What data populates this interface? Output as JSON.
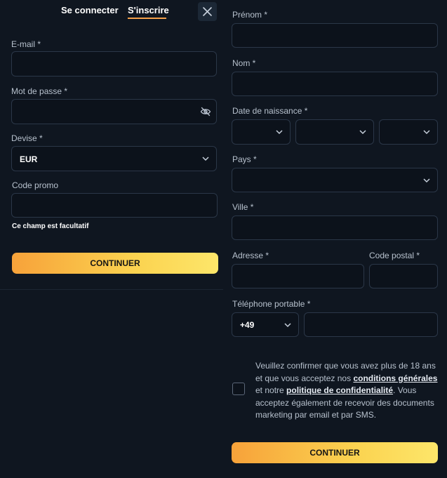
{
  "tabs": {
    "login": "Se connecter",
    "signup": "S'inscrire"
  },
  "left_form": {
    "email_label": "E-mail *",
    "email_value": "",
    "password_label": "Mot de passe *",
    "password_value": "",
    "currency_label": "Devise *",
    "currency_value": "EUR",
    "promo_label": "Code promo",
    "promo_value": "",
    "promo_note": "Ce champ est facultatif",
    "continue_label": "CONTINUER"
  },
  "right_form": {
    "firstname_label": "Prénom *",
    "lastname_label": "Nom *",
    "birthdate_label": "Date de naissance *",
    "country_label": "Pays *",
    "city_label": "Ville *",
    "address_label": "Adresse *",
    "postal_label": "Code postal *",
    "phone_label": "Téléphone portable *",
    "phone_prefix": "+49",
    "consent": {
      "part1": "Veuillez confirmer que vous avez plus de 18 ans et que vous acceptez nos ",
      "link1": "conditions générales",
      "part2": " et notre ",
      "link2": "politique de confidentialité",
      "part3": ". Vous acceptez également de recevoir des documents marketing par email et par SMS."
    },
    "continue_label": "CONTINUER"
  },
  "icons": {
    "close": "close-icon",
    "eye": "eye-off-icon",
    "chevron": "chevron-down-icon"
  },
  "colors": {
    "background": "#0f1620",
    "button_start": "#f7a23a",
    "button_end": "#fde66a",
    "tab_accent": "#f5a04a"
  }
}
